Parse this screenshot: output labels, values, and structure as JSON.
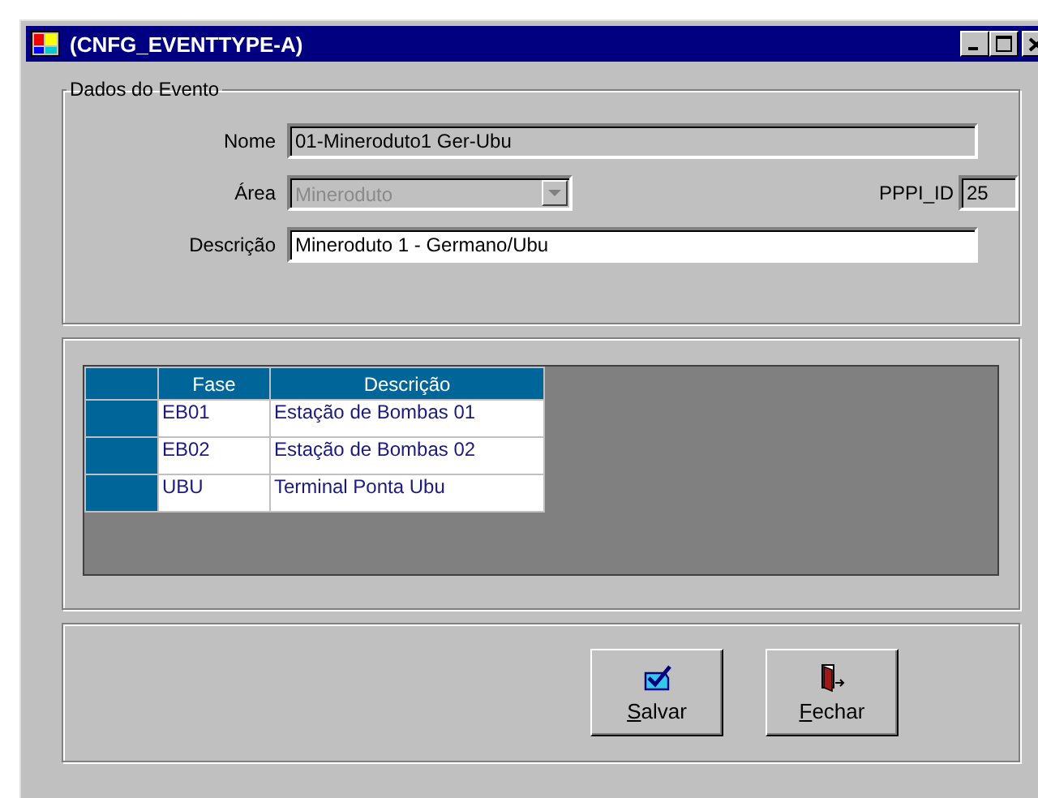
{
  "window": {
    "title": "(CNFG_EVENTTYPE-A)"
  },
  "event_group": {
    "legend": "Dados do Evento",
    "nome": {
      "label": "Nome",
      "value": "01-Mineroduto1 Ger-Ubu",
      "readonly": true
    },
    "area": {
      "label": "Área",
      "value": "Mineroduto",
      "disabled": true
    },
    "pppi_id": {
      "label": "PPPI_ID",
      "value": "25",
      "readonly": true
    },
    "descricao": {
      "label": "Descrição",
      "value": "Mineroduto 1 - Germano/Ubu",
      "readonly": false
    }
  },
  "grid": {
    "columns": [
      "Fase",
      "Descrição"
    ],
    "rows": [
      {
        "cells": [
          "EB01",
          "Estação de Bombas 01"
        ]
      },
      {
        "cells": [
          "EB02",
          "Estação de Bombas 02"
        ]
      },
      {
        "cells": [
          "UBU",
          "Terminal Ponta Ubu"
        ]
      }
    ]
  },
  "buttons": [
    {
      "kind": "save",
      "label": "Salvar",
      "underline_first": true
    },
    {
      "kind": "close",
      "label": "Fechar",
      "underline_first": true
    }
  ]
}
